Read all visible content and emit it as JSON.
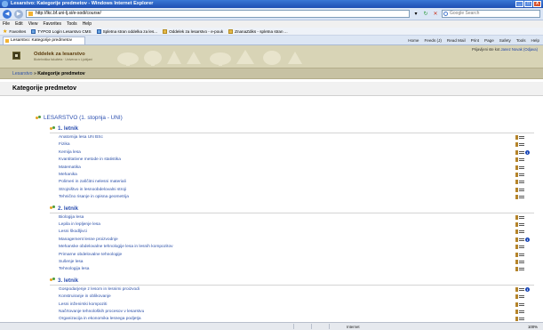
{
  "window": {
    "title": "Lesarstvo: Kategorije predmetov - Windows Internet Explorer",
    "min": "_",
    "max": "□",
    "close": "X"
  },
  "address": {
    "url": "http://lkc.bf.uni-lj.si/e-sodi/course/",
    "search_placeholder": "Google Search"
  },
  "menu": [
    "File",
    "Edit",
    "View",
    "Favorites",
    "Tools",
    "Help"
  ],
  "favorites": {
    "label": "Favorites",
    "items": [
      "TYPO3 Login Lesarstvo CMS",
      "Spletna stran oddelka za les...",
      "Oddelek za lesarstvo - e-pouk",
      "ZnanaZdiks - spletna stran ..."
    ]
  },
  "tab": {
    "label": "Lesarstvo: Kategorije predmetov"
  },
  "commands": [
    "Home",
    "Feeds (J)",
    "Read Mail",
    "Print",
    "Page",
    "Safety",
    "Tools",
    "Help"
  ],
  "banner": {
    "name": "Oddelek za lesarstvo",
    "subtitle": "Biotehniška fakulteta · Univerza v Ljubljani",
    "login_prefix": "Prijavljeni ste kot",
    "login_user": "Janez Novak",
    "login_action": "(Odjava)"
  },
  "breadcrumb": {
    "home": "Lesarstvo",
    "sep": "»",
    "current": "Kategorije predmetov"
  },
  "section_title": "Kategorije predmetov",
  "category": "LESARSTVO (1. stopnja - UNI)",
  "years": [
    {
      "title": "1. letnik",
      "courses": [
        {
          "name": "Anatomija lesa UN BSc",
          "info": false
        },
        {
          "name": "Fizika",
          "info": false
        },
        {
          "name": "Kemija lesa",
          "info": true
        },
        {
          "name": "Kvantitativne metode in statistika",
          "info": false
        },
        {
          "name": "Matematika",
          "info": false
        },
        {
          "name": "Mehanika",
          "info": false
        },
        {
          "name": "Polimeri in zaščitni nelesni materiali",
          "info": false
        },
        {
          "name": "Strojništvo in lesnoobdelovalni stroji",
          "info": false
        },
        {
          "name": "Tehnično risanje in opisna geometrija",
          "info": false
        }
      ]
    },
    {
      "title": "2. letnik",
      "courses": [
        {
          "name": "Biologija lesa",
          "info": false
        },
        {
          "name": "Lepila in lepljenje lesa",
          "info": false
        },
        {
          "name": "Lesni škodljivci",
          "info": false
        },
        {
          "name": "Management lesne proizvodnje",
          "info": true
        },
        {
          "name": "Mehanske obdelovalne tehnologije lesa in lesnih kompozitov",
          "info": false
        },
        {
          "name": "Primarne obdelovalne tehnologije",
          "info": false
        },
        {
          "name": "Sušenje lesa",
          "info": false
        },
        {
          "name": "Tehnologija lesa",
          "info": false
        }
      ]
    },
    {
      "title": "3. letnik",
      "courses": [
        {
          "name": "Gospodarjenje z lesom in lesnimi proizvodi",
          "info": true
        },
        {
          "name": "Konstruiranje in oblikovanje",
          "info": false
        },
        {
          "name": "Lesni inženirski kompoziti",
          "info": false
        },
        {
          "name": "Načrtovanje tehnoloških procesov v lesarstvu",
          "info": false
        },
        {
          "name": "Organizacija in ekonomika lesnega podjetja",
          "info": false
        }
      ]
    }
  ],
  "status": {
    "zone": "Internet",
    "zoom": "100%"
  },
  "colors": {
    "link": "#2c50a8",
    "banner": "#d8d4b6",
    "crumbs": "#c7c2a3",
    "title_bar": "#1f4fb3"
  }
}
